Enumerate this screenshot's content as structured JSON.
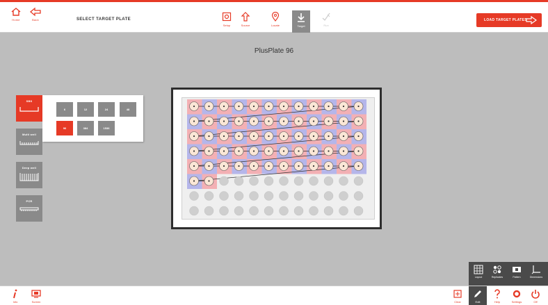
{
  "header": {
    "title": "SELECT TARGET PLATE",
    "home_label": "Home",
    "back_label": "Back",
    "load_button": "LOAD TARGET PLATES"
  },
  "workflow": [
    {
      "label": "Setup",
      "icon": "setup-icon",
      "state": "done"
    },
    {
      "label": "Source",
      "icon": "source-icon",
      "state": "done"
    },
    {
      "label": "Locate",
      "icon": "locate-icon",
      "state": "done"
    },
    {
      "label": "Target",
      "icon": "target-icon",
      "state": "active"
    },
    {
      "label": "Run",
      "icon": "run-icon",
      "state": "disabled"
    }
  ],
  "plate": {
    "name": "PlusPlate 96",
    "rows": 8,
    "cols": 12,
    "assigned_wells": 62
  },
  "plate_types": {
    "categories": [
      {
        "label": "SBS",
        "active": true
      },
      {
        "label": "Multi well",
        "active": false
      },
      {
        "label": "Deep well",
        "active": false
      },
      {
        "label": "PCR",
        "active": false
      }
    ],
    "formats": [
      {
        "label": "6",
        "active": false
      },
      {
        "label": "12",
        "active": false
      },
      {
        "label": "24",
        "active": false
      },
      {
        "label": "48",
        "active": false
      },
      {
        "label": "96",
        "active": true
      },
      {
        "label": "384",
        "active": false
      },
      {
        "label": "1536",
        "active": false
      }
    ]
  },
  "tools": [
    {
      "label": "Layout",
      "icon": "layout-icon"
    },
    {
      "label": "Replicates",
      "icon": "replicates-icon"
    },
    {
      "label": "Pattern",
      "icon": "pattern-icon"
    },
    {
      "label": "Dimensions",
      "icon": "dimensions-icon"
    }
  ],
  "footer": {
    "info_label": "Info",
    "screen_label": "Screen",
    "clear_label": "Clear",
    "edit_label": "Edit",
    "help_label": "Help",
    "settings_label": "Settings",
    "off_label": "Off"
  },
  "colors": {
    "accent": "#e63a26",
    "well_row_a": "#f3b0b4",
    "well_row_b": "#b5b6ea",
    "well_unassigned": "#cfcfcf"
  }
}
